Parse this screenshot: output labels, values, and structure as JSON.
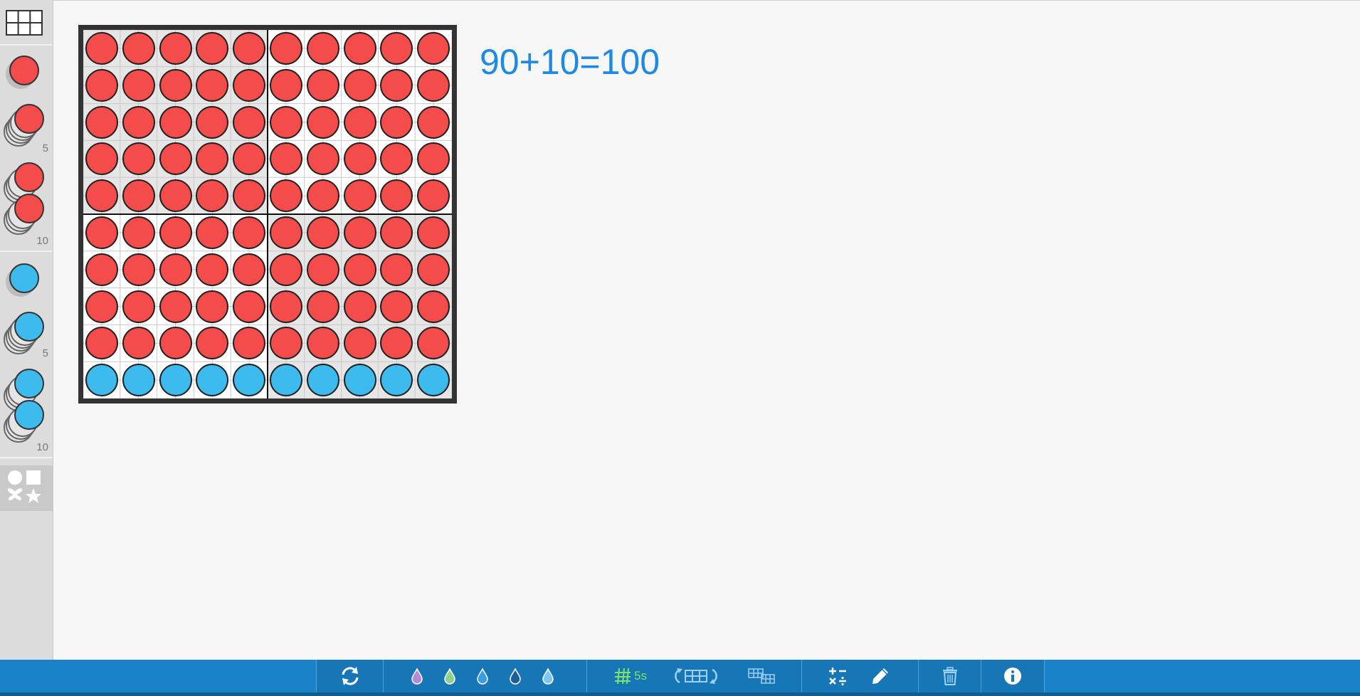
{
  "sidebar": {
    "frame_button_icon": "ten-frame-grid-icon",
    "red_single_icon": "red-counter-icon",
    "red_stack5_icon": "red-counter-stack-icon",
    "red_stack5_count": "5",
    "red_stack10_icon": "red-counter-double-stack-icon",
    "red_stack10_count": "10",
    "blue_single_icon": "blue-counter-icon",
    "blue_stack5_icon": "blue-counter-stack-icon",
    "blue_stack5_count": "5",
    "blue_stack10_icon": "blue-counter-double-stack-icon",
    "blue_stack10_count": "10",
    "shapes_icon": "shapes-icon"
  },
  "board": {
    "rows": [
      [
        "red",
        "red",
        "red",
        "red",
        "red",
        "red",
        "red",
        "red",
        "red",
        "red"
      ],
      [
        "red",
        "red",
        "red",
        "red",
        "red",
        "red",
        "red",
        "red",
        "red",
        "red"
      ],
      [
        "red",
        "red",
        "red",
        "red",
        "red",
        "red",
        "red",
        "red",
        "red",
        "red"
      ],
      [
        "red",
        "red",
        "red",
        "red",
        "red",
        "red",
        "red",
        "red",
        "red",
        "red"
      ],
      [
        "red",
        "red",
        "red",
        "red",
        "red",
        "red",
        "red",
        "red",
        "red",
        "red"
      ],
      [
        "red",
        "red",
        "red",
        "red",
        "red",
        "red",
        "red",
        "red",
        "red",
        "red"
      ],
      [
        "red",
        "red",
        "red",
        "red",
        "red",
        "red",
        "red",
        "red",
        "red",
        "red"
      ],
      [
        "red",
        "red",
        "red",
        "red",
        "red",
        "red",
        "red",
        "red",
        "red",
        "red"
      ],
      [
        "red",
        "red",
        "red",
        "red",
        "red",
        "red",
        "red",
        "red",
        "red",
        "red"
      ],
      [
        "blue",
        "blue",
        "blue",
        "blue",
        "blue",
        "blue",
        "blue",
        "blue",
        "blue",
        "blue"
      ]
    ]
  },
  "equation": "90+10=100",
  "toolbar": {
    "refresh_icon": "refresh-icon",
    "color_drops": [
      "purple-drop-icon",
      "green-drop-icon",
      "blue-drop-icon",
      "navy-drop-icon",
      "light-blue-drop-icon"
    ],
    "grid_label": "5s",
    "grid_icon": "grid-hash-icon",
    "rotate_frame_icon": "rotate-frame-icon",
    "frame_layout_icon": "frame-layout-icon",
    "operations_icon": "math-operations-icon",
    "pencil_icon": "pencil-icon",
    "trash_icon": "trash-icon",
    "info_icon": "info-icon"
  },
  "colors": {
    "red": "#f44b4b",
    "blue": "#3dbbef",
    "equation": "#1f8ae6",
    "toolbar": "#1a82c7"
  }
}
